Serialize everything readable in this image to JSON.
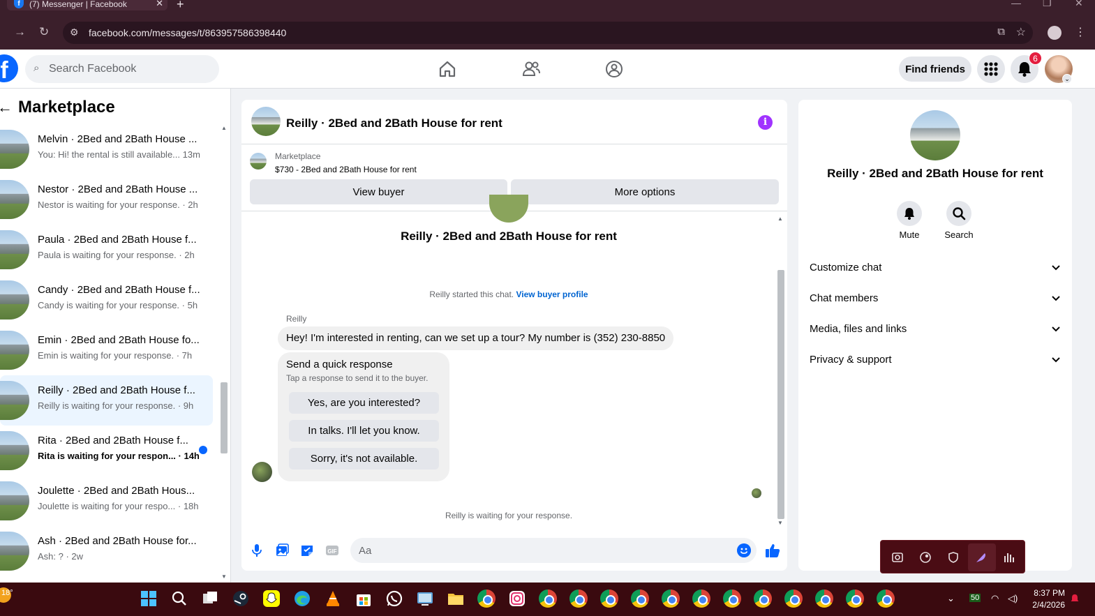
{
  "browser": {
    "tab_title": "(7) Messenger | Facebook",
    "url": "facebook.com/messages/t/863957586398440"
  },
  "fb": {
    "logo": "f",
    "search_placeholder": "Search Facebook",
    "find_friends": "Find friends",
    "notif_count": "6"
  },
  "sidebar": {
    "title": "Marketplace",
    "conversations": [
      {
        "name": "Melvin · 2Bed and 2Bath House ...",
        "preview": "You: Hi! the rental is still available... 13m",
        "unread": false,
        "active": false
      },
      {
        "name": "Nestor · 2Bed and 2Bath House ...",
        "preview": "Nestor is waiting for your response. · 2h",
        "unread": false,
        "active": false
      },
      {
        "name": "Paula · 2Bed and 2Bath House f...",
        "preview": "Paula is waiting for your response. · 2h",
        "unread": false,
        "active": false
      },
      {
        "name": "Candy · 2Bed and 2Bath House f...",
        "preview": "Candy is waiting for your response. · 5h",
        "unread": false,
        "active": false
      },
      {
        "name": "Emin · 2Bed and 2Bath House fo...",
        "preview": "Emin is waiting for your response. · 7h",
        "unread": false,
        "active": false
      },
      {
        "name": "Reilly · 2Bed and 2Bath House f...",
        "preview": "Reilly is waiting for your response. · 9h",
        "unread": false,
        "active": true
      },
      {
        "name": "Rita · 2Bed and 2Bath House f...",
        "preview": "Rita is waiting for your respon... · 14h",
        "unread": true,
        "active": false
      },
      {
        "name": "Joulette · 2Bed and 2Bath Hous...",
        "preview": "Joulette is waiting for your respo... · 18h",
        "unread": false,
        "active": false
      },
      {
        "name": "Ash · 2Bed and 2Bath House for...",
        "preview": "Ash: ? · 2w",
        "unread": false,
        "active": false
      }
    ]
  },
  "chat": {
    "title": "Reilly · 2Bed and 2Bath House for rent",
    "marketplace_label": "Marketplace",
    "listing": "$730 - 2Bed and 2Bath House for rent",
    "view_buyer": "View buyer",
    "more_options": "More options",
    "conversation_title": "Reilly · 2Bed and 2Bath House for rent",
    "started_text": "Reilly started this chat.",
    "view_buyer_profile": "View buyer profile",
    "sender": "Reilly",
    "message": "Hey! I'm interested in renting, can we set up a tour? My number is (352) 230-8850",
    "quick_title": "Send a quick response",
    "quick_sub": "Tap a response to send it to the buyer.",
    "quick_responses": [
      "Yes, are you interested?",
      "In talks. I'll let you know.",
      "Sorry, it's not available."
    ],
    "waiting": "Reilly is waiting for your response.",
    "compose_placeholder": "Aa"
  },
  "details": {
    "title": "Reilly · 2Bed and 2Bath House for rent",
    "mute": "Mute",
    "search": "Search",
    "sections": [
      "Customize chat",
      "Chat members",
      "Media, files and links",
      "Privacy & support"
    ]
  },
  "taskbar": {
    "temp": "18°",
    "battery": "50",
    "time": "8:37 PM",
    "date": "2/4/2026"
  }
}
